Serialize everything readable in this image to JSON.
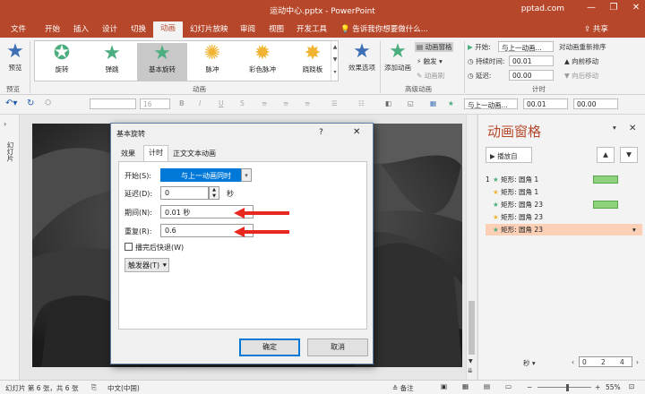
{
  "titlebar": {
    "title": "运动中心.pptx - PowerPoint",
    "site": "pptad.com",
    "minimize": "—",
    "restore": "❐",
    "close": "✕"
  },
  "tabs": [
    "文件",
    "开始",
    "插入",
    "设计",
    "切换",
    "动画",
    "幻灯片放映",
    "审阅",
    "视图",
    "开发工具"
  ],
  "tell_me": "告诉我你想要做什么...",
  "share": "共享",
  "ribbon": {
    "preview": "预览",
    "effects": [
      "旋转",
      "弹跳",
      "基本旋转",
      "脉冲",
      "彩色脉冲",
      "跷跷板"
    ],
    "effect_options": "效果选项",
    "add_animation": "添加动画",
    "animation_pane": "动画窗格",
    "trigger": "触发",
    "painter": "动画刷",
    "start_label": "开始:",
    "start_value": "与上一动画...",
    "duration_label": "持续时间:",
    "duration_value": "00.01",
    "delay_label": "延迟:",
    "delay_value": "00.00",
    "reorder": "对动画重新排序",
    "move_earlier": "向前移动",
    "move_later": "向后移动",
    "groups": [
      "预览",
      "动画",
      "高级动画",
      "计时"
    ]
  },
  "toolbar": {
    "font_size": "16",
    "start_short": "与上一动画...",
    "rotation": "00.01",
    "delay_short": "00.00"
  },
  "left_strip": "幻灯片",
  "pane": {
    "title": "动画窗格",
    "play_from": "播放自",
    "seconds": "秒",
    "zoom_ruler": [
      "0",
      "2",
      "4"
    ],
    "items": [
      {
        "num": "1",
        "label": "矩形: 圆角 1",
        "bar": true
      },
      {
        "num": "",
        "label": "矩形: 圆角 1",
        "bar": false
      },
      {
        "num": "",
        "label": "矩形: 圆角 23",
        "bar": true
      },
      {
        "num": "",
        "label": "矩形: 圆角 23",
        "bar": false
      },
      {
        "num": "",
        "label": "矩形: 圆角 23",
        "bar": false
      }
    ]
  },
  "dialog": {
    "title": "基本旋转",
    "help": "?",
    "close": "✕",
    "tabs": [
      "效果",
      "计时",
      "正文文本动画"
    ],
    "start_label": "开始(S):",
    "start_value": "与上一动画同时",
    "delay_label": "延迟(D):",
    "delay_value": "0",
    "delay_unit": "秒",
    "duration_label": "期间(N):",
    "duration_value": "0.01 秒",
    "repeat_label": "重复(R):",
    "repeat_value": "0.6",
    "rewind_label": "播完后快退(W)",
    "rewind_checked": false,
    "triggers_label": "触发器(T)",
    "ok": "确定",
    "cancel": "取消"
  },
  "status": {
    "slide_info": "幻灯片 第 6 张，共 6 张",
    "language": "中文(中国)",
    "notes": "备注",
    "zoom": "55%",
    "minus": "−",
    "plus": "+"
  }
}
